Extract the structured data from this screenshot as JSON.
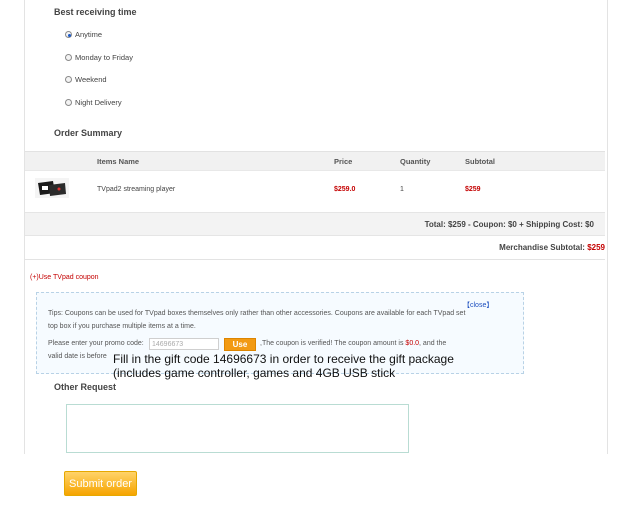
{
  "receiving_time": {
    "title": "Best receiving time",
    "options": [
      {
        "label": "Anytime",
        "checked": true
      },
      {
        "label": "Monday to Friday",
        "checked": false
      },
      {
        "label": "Weekend",
        "checked": false
      },
      {
        "label": "Night Delivery",
        "checked": false
      }
    ]
  },
  "order_summary": {
    "title": "Order Summary",
    "columns": {
      "items_name": "Items Name",
      "price": "Price",
      "quantity": "Quantity",
      "subtotal": "Subtotal"
    },
    "items": [
      {
        "image_icon": "tvpad-box-thumbnail",
        "name": "TVpad2 streaming player",
        "price": "$259.0",
        "quantity": "1",
        "subtotal": "$259"
      }
    ],
    "totals_line": "Total: $259 - Coupon: $0 + Shipping Cost: $0",
    "merchandise_label": "Merchandise Subtotal:",
    "merchandise_value": "$259"
  },
  "coupon": {
    "link_label": "(+)Use TVpad coupon",
    "close_label": "【close】",
    "tips": "Tips: Coupons can be used for TVpad boxes themselves only rather than other accessories. Coupons are available for each TVpad set top box if you purchase multiple items at a time.",
    "promo_label": "Please enter your promo code:",
    "promo_value": "14696673",
    "use_label": "Use",
    "verified_prefix": ",The coupon is verified! The coupon amount is",
    "verified_amount": "$0.0",
    "verified_suffix": ", and the",
    "valid_label": "valid date is before"
  },
  "overlay": {
    "line1": "Fill in the gift code 14696673 in order to receive the gift package",
    "line2": "(includes game controller, games and 4GB USB stick"
  },
  "other_request": {
    "title": "Other Request",
    "value": ""
  },
  "submit_label": "Submit order",
  "colors": {
    "accent_red": "#c40000",
    "button_orange": "#f29a13",
    "link_blue": "#1d4fbf"
  }
}
